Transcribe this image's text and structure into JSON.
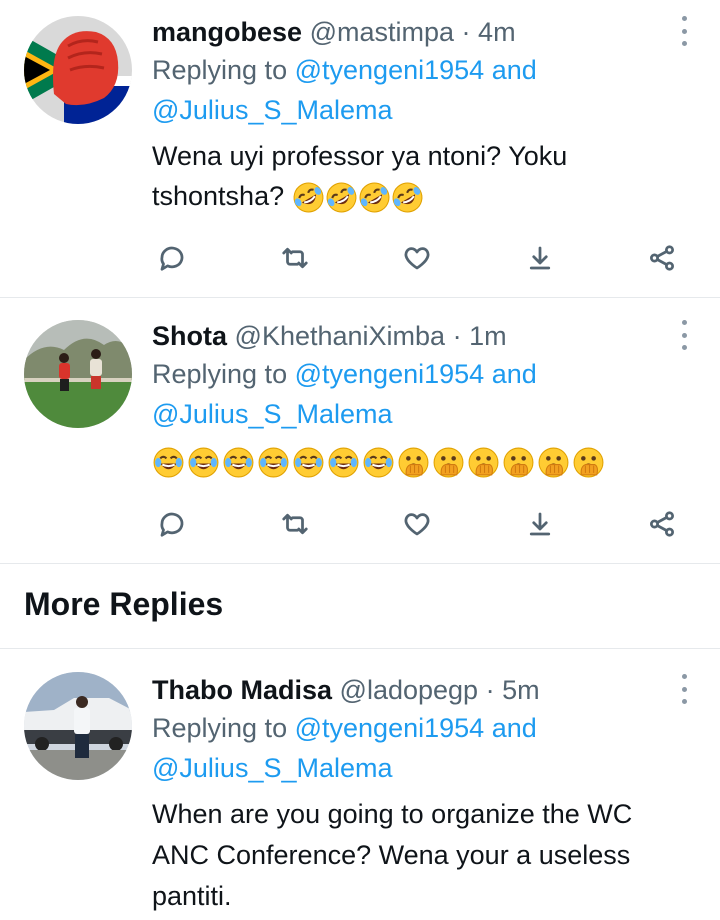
{
  "tweets": [
    {
      "name": "mangobese",
      "handle": "@mastimpa",
      "time": "4m",
      "replying_prefix": "Replying to",
      "reply_user1": "@tyengeni1954",
      "reply_and": "and",
      "reply_user2": "@Julius_S_Malema",
      "text_line1": "Wena uyi professor ya ntoni? Yoku",
      "text_line2": "tshontsha?",
      "emojis": [
        "rolling-on-floor-laughing",
        "rolling-on-floor-laughing",
        "rolling-on-floor-laughing",
        "rolling-on-floor-laughing"
      ]
    },
    {
      "name": "Shota",
      "handle": "@KhethaniXimba",
      "time": "1m",
      "replying_prefix": "Replying to",
      "reply_user1": "@tyengeni1954",
      "reply_and": "and",
      "reply_user2": "@Julius_S_Malema",
      "emojis": [
        "face-with-tears-of-joy",
        "face-with-tears-of-joy",
        "face-with-tears-of-joy",
        "face-with-tears-of-joy",
        "face-with-tears-of-joy",
        "face-with-tears-of-joy",
        "face-with-tears-of-joy",
        "face-with-open-eyes-and-hand-over-mouth",
        "face-with-open-eyes-and-hand-over-mouth",
        "face-with-open-eyes-and-hand-over-mouth",
        "face-with-open-eyes-and-hand-over-mouth",
        "face-with-open-eyes-and-hand-over-mouth",
        "face-with-open-eyes-and-hand-over-mouth"
      ]
    },
    {
      "name": "Thabo Madisa",
      "handle": "@ladopegp",
      "time": "5m",
      "replying_prefix": "Replying to",
      "reply_user1": "@tyengeni1954",
      "reply_and": "and",
      "reply_user2": "@Julius_S_Malema",
      "text_line1": "When are you going to organize the WC",
      "text_line2": "ANC Conference? Wena your a useless",
      "text_line3": "pantiti."
    }
  ],
  "section_title": "More Replies",
  "separator": "·",
  "action_icons": [
    "reply-icon",
    "retweet-icon",
    "like-icon",
    "bookmark-icon",
    "share-icon"
  ],
  "colors": {
    "link": "#1d9bf0",
    "muted": "#536471",
    "text": "#0f1419"
  }
}
